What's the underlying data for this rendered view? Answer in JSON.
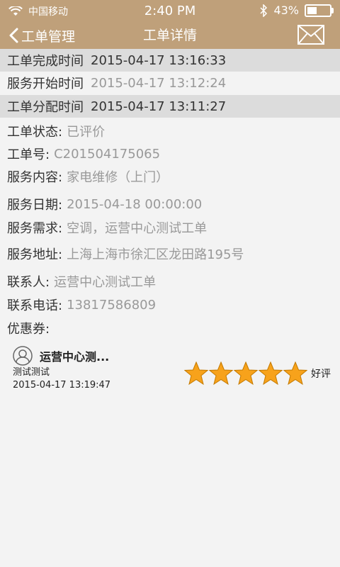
{
  "status_bar": {
    "carrier": "中国移动",
    "time": "2:40 PM",
    "battery": "43%",
    "battery_level": 0.43
  },
  "nav": {
    "back_label": "工单管理",
    "title": "工单详情"
  },
  "timeline": [
    {
      "label": "工单完成时间",
      "value": "2015-04-17 13:16:33"
    },
    {
      "label": "服务开始时间",
      "value": "2015-04-17 13:12:24"
    },
    {
      "label": "工单分配时间",
      "value": "2015-04-17 13:11:27"
    }
  ],
  "details": [
    {
      "label": "工单状态:",
      "value": "已评价"
    },
    {
      "label": "工单号:",
      "value": "C201504175065"
    },
    {
      "label": "服务内容:",
      "value": "家电维修（上门）"
    },
    {
      "label": "服务日期:",
      "value": "2015-04-18 00:00:00"
    },
    {
      "label": "服务需求:",
      "value": "空调，运营中心测试工单"
    },
    {
      "label": "服务地址:",
      "value": "上海上海市徐汇区龙田路195号"
    },
    {
      "label": "联系人:",
      "value": "运营中心测试工单"
    },
    {
      "label": "联系电话:",
      "value": "13817586809"
    },
    {
      "label": "优惠券:",
      "value": ""
    }
  ],
  "review": {
    "name": "运营中心测...",
    "comment": "测试测试",
    "time": "2015-04-17 13:19:47",
    "stars": 5,
    "rating_label": "好评",
    "star_color": "#f7a21b"
  },
  "colors": {
    "header": "#bfa07a",
    "shaded_row": "#dcdcdc",
    "value_gray": "#999999"
  }
}
